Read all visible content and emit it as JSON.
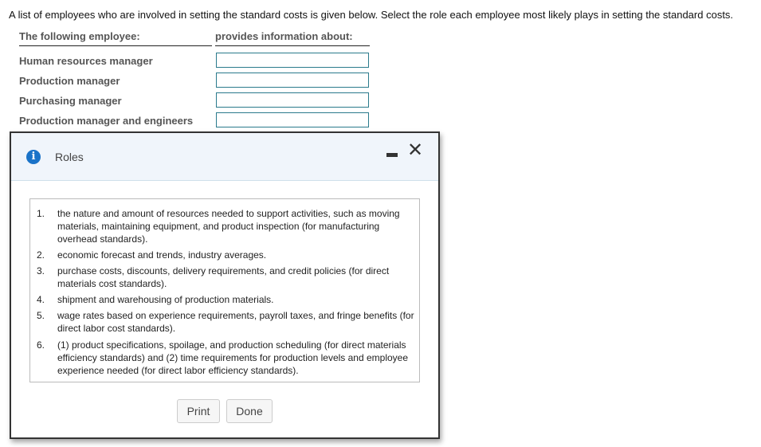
{
  "instructions": "A list of employees who are involved in setting the standard costs is given below. Select the role each employee most likely plays in setting the standard costs.",
  "table": {
    "headers": {
      "employee": "The following employee:",
      "info": "provides information about:"
    },
    "rows": [
      {
        "employee": "Human resources manager",
        "value": ""
      },
      {
        "employee": "Production manager",
        "value": ""
      },
      {
        "employee": "Purchasing manager",
        "value": ""
      },
      {
        "employee": "Production manager and engineers",
        "value": ""
      }
    ]
  },
  "dialog": {
    "title": "Roles",
    "icons": {
      "info": "info-icon",
      "minimize": "minimize-icon",
      "close": "close-icon"
    },
    "info_glyph": "i",
    "close_glyph": "✕",
    "items": [
      {
        "num": "1.",
        "text": "the nature and amount of resources needed to support activities, such as moving materials, maintaining equipment, and product inspection (for manufacturing overhead standards)."
      },
      {
        "num": "2.",
        "text": "economic forecast and trends, industry averages."
      },
      {
        "num": "3.",
        "text": "purchase costs, discounts, delivery requirements, and credit policies (for direct materials cost standards)."
      },
      {
        "num": "4.",
        "text": "shipment and warehousing of production materials."
      },
      {
        "num": "5.",
        "text": "wage rates based on experience requirements, payroll taxes, and fringe benefits (for direct labor cost standards)."
      },
      {
        "num": "6.",
        "text": "(1) product specifications, spoilage, and production scheduling (for direct materials efficiency standards) and (2) time requirements for production levels and employee experience needed (for direct labor efficiency standards)."
      }
    ],
    "buttons": {
      "print": "Print",
      "done": "Done"
    }
  },
  "colors": {
    "input_border": "#2a7a8c",
    "header_bg": "#f0f5fb",
    "info_icon": "#1a73c8"
  }
}
